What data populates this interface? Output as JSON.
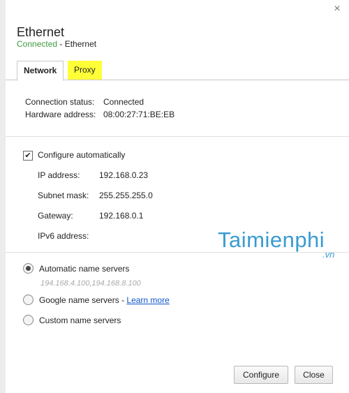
{
  "dialog": {
    "title": "Ethernet",
    "status": "Connected",
    "separator": " - ",
    "device": "Ethernet",
    "close_glyph": "×"
  },
  "tabs": [
    {
      "label": "Network",
      "selected": true
    },
    {
      "label": "Proxy",
      "selected": false,
      "highlight": "#ffff38"
    }
  ],
  "connection": {
    "status_label": "Connection status:",
    "status_value": "Connected",
    "hardware_label": "Hardware address:",
    "hardware_value": "08:00:27:71:BE:EB"
  },
  "ip_config": {
    "configure_automatically_label": "Configure automatically",
    "configure_automatically_checked": true,
    "fields": [
      {
        "label": "IP address:",
        "value": "192.168.0.23"
      },
      {
        "label": "Subnet mask:",
        "value": "255.255.255.0"
      },
      {
        "label": "Gateway:",
        "value": "192.168.0.1"
      },
      {
        "label": "IPv6 address:",
        "value": ""
      }
    ]
  },
  "name_servers": {
    "automatic_label": "Automatic name servers",
    "automatic_servers": "194.168.4.100,194.168.8.100",
    "google_label": "Google name servers",
    "google_separator": " - ",
    "learn_more": "Learn more",
    "custom_label": "Custom name servers",
    "selected": "automatic"
  },
  "buttons": {
    "configure": "Configure",
    "close": "Close"
  },
  "watermark": {
    "main": "Taimienphi",
    "suffix": ".vn"
  },
  "colors": {
    "connected_green": "#3d9a3d",
    "link_blue": "#1155cc",
    "proxy_highlight": "#ffff38",
    "watermark_blue": "#3a9bd0"
  }
}
